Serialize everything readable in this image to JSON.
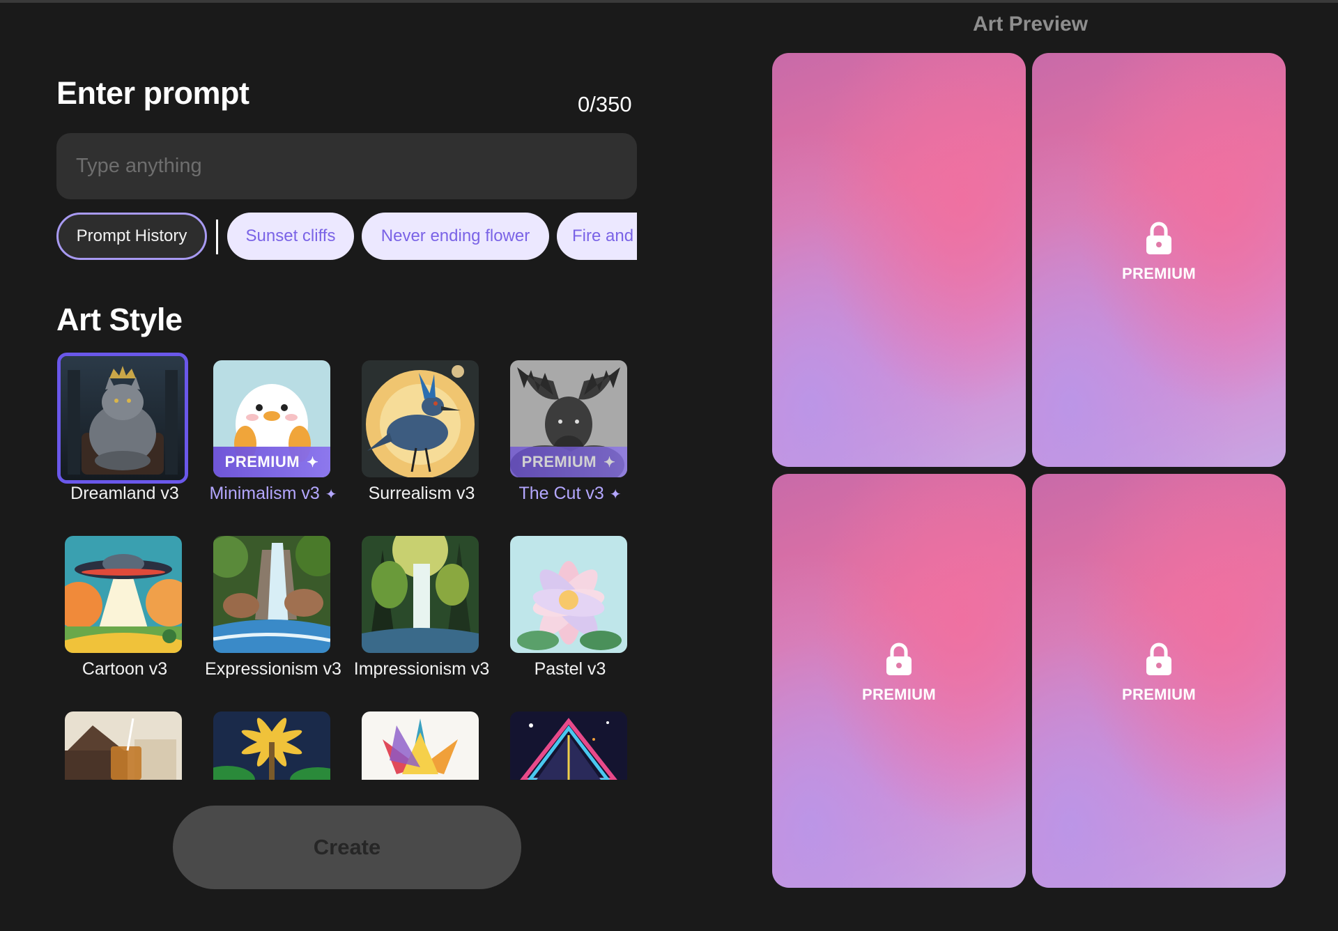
{
  "prompt": {
    "title": "Enter prompt",
    "count": "0/350",
    "placeholder": "Type anything",
    "value": ""
  },
  "chips": {
    "history": "Prompt History",
    "suggestions": [
      "Sunset cliffs",
      "Never ending flower",
      "Fire and"
    ]
  },
  "art_style": {
    "title": "Art Style",
    "styles": [
      {
        "label": "Dreamland v3",
        "premium": false,
        "selected": true
      },
      {
        "label": "Minimalism v3",
        "premium": true,
        "badge": "PREMIUM"
      },
      {
        "label": "Surrealism v3",
        "premium": false
      },
      {
        "label": "The Cut v3",
        "premium": true,
        "badge": "PREMIUM"
      },
      {
        "label": "Cartoon v3",
        "premium": false
      },
      {
        "label": "Expressionism v3",
        "premium": false
      },
      {
        "label": "Impressionism v3",
        "premium": false
      },
      {
        "label": "Pastel v3",
        "premium": false
      }
    ]
  },
  "create_button": "Create",
  "preview": {
    "title": "Art Preview",
    "cards": [
      {
        "locked": false
      },
      {
        "locked": true,
        "label": "PREMIUM"
      },
      {
        "locked": true,
        "label": "PREMIUM"
      },
      {
        "locked": true,
        "label": "PREMIUM"
      }
    ]
  },
  "colors": {
    "background": "#1a1a1a",
    "accent": "#6a58ea",
    "premium_text": "#b4a7ff",
    "chip_bg": "#ece8ff"
  }
}
